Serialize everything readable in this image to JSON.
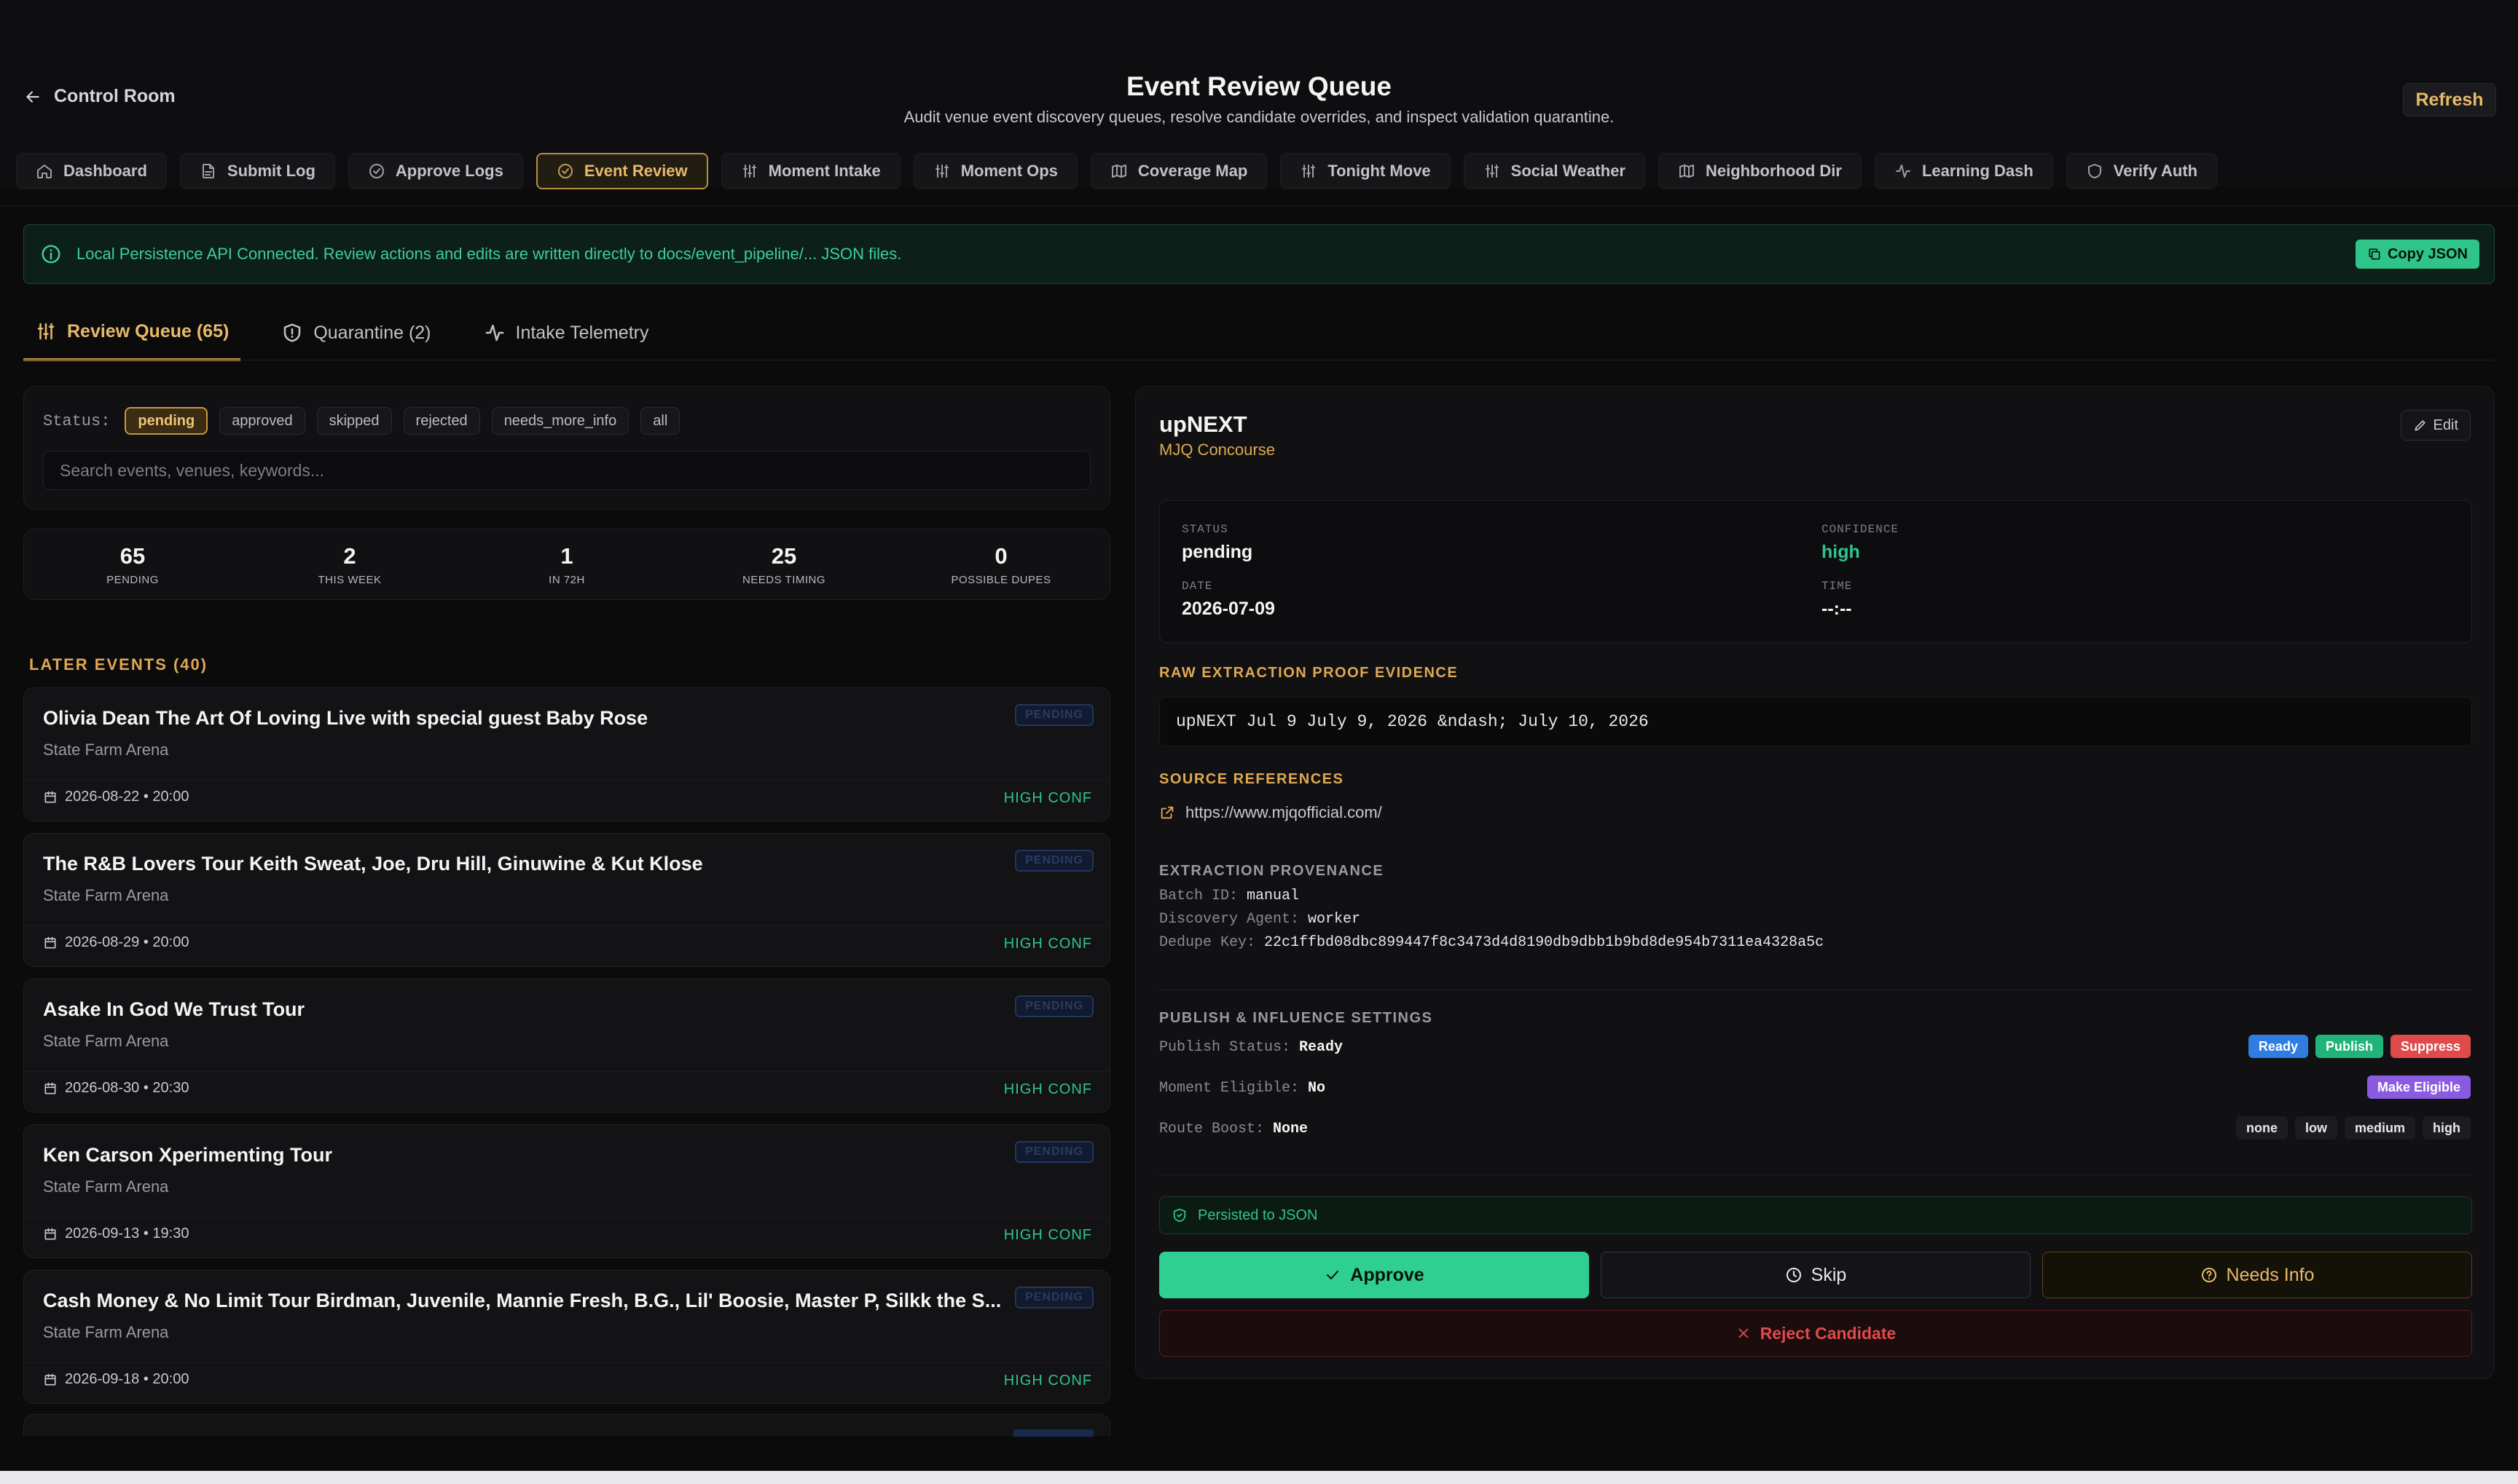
{
  "header": {
    "back_label": "Control Room",
    "title": "Event Review Queue",
    "subtitle": "Audit venue event discovery queues, resolve candidate overrides, and inspect validation quarantine.",
    "refresh_label": "Refresh"
  },
  "nav": [
    {
      "label": "Dashboard",
      "icon": "home-icon"
    },
    {
      "label": "Submit Log",
      "icon": "file-icon"
    },
    {
      "label": "Approve Logs",
      "icon": "check-circle-icon"
    },
    {
      "label": "Event Review",
      "icon": "check-circle-icon",
      "active": true
    },
    {
      "label": "Moment Intake",
      "icon": "sliders-icon"
    },
    {
      "label": "Moment Ops",
      "icon": "sliders-icon"
    },
    {
      "label": "Coverage Map",
      "icon": "map-icon"
    },
    {
      "label": "Tonight Move",
      "icon": "sliders-icon"
    },
    {
      "label": "Social Weather",
      "icon": "sliders-icon"
    },
    {
      "label": "Neighborhood Dir",
      "icon": "map-icon"
    },
    {
      "label": "Learning Dash",
      "icon": "activity-icon"
    },
    {
      "label": "Verify Auth",
      "icon": "shield-icon"
    }
  ],
  "banner": {
    "text": "Local Persistence API Connected. Review actions and edits are written directly to docs/event_pipeline/... JSON files.",
    "copy_label": "Copy JSON"
  },
  "subtabs": [
    {
      "label": "Review Queue (65)",
      "active": true
    },
    {
      "label": "Quarantine (2)"
    },
    {
      "label": "Intake Telemetry"
    }
  ],
  "filters": {
    "status_label": "Status:",
    "chips": [
      "pending",
      "approved",
      "skipped",
      "rejected",
      "needs_more_info",
      "all"
    ],
    "active_chip": "pending",
    "search_placeholder": "Search events, venues, keywords..."
  },
  "stats": [
    {
      "value": "65",
      "label": "PENDING"
    },
    {
      "value": "2",
      "label": "THIS WEEK"
    },
    {
      "value": "1",
      "label": "IN 72H"
    },
    {
      "value": "25",
      "label": "NEEDS TIMING"
    },
    {
      "value": "0",
      "label": "POSSIBLE DUPES"
    }
  ],
  "section_title": "LATER EVENTS (40)",
  "events": [
    {
      "title": "Olivia Dean The Art Of Loving Live with special guest Baby Rose",
      "venue": "State Farm Arena",
      "datetime": "2026-08-22 • 20:00",
      "badge": "PENDING",
      "conf": "HIGH CONF"
    },
    {
      "title": "The R&B Lovers Tour Keith Sweat, Joe, Dru Hill, Ginuwine & Kut Klose",
      "venue": "State Farm Arena",
      "datetime": "2026-08-29 • 20:00",
      "badge": "PENDING",
      "conf": "HIGH CONF"
    },
    {
      "title": "Asake In God We Trust Tour",
      "venue": "State Farm Arena",
      "datetime": "2026-08-30 • 20:30",
      "badge": "PENDING",
      "conf": "HIGH CONF"
    },
    {
      "title": "Ken Carson Xperimenting Tour",
      "venue": "State Farm Arena",
      "datetime": "2026-09-13 • 19:30",
      "badge": "PENDING",
      "conf": "HIGH CONF"
    },
    {
      "title": "Cash Money & No Limit Tour Birdman, Juvenile, Mannie Fresh, B.G., Lil' Boosie, Master P, Silkk the S...",
      "venue": "State Farm Arena",
      "datetime": "2026-09-18 • 20:00",
      "badge": "PENDING",
      "conf": "HIGH CONF"
    }
  ],
  "detail": {
    "name": "upNEXT",
    "venue": "MJQ Concourse",
    "edit_label": "Edit",
    "status_key": "STATUS",
    "status_value": "pending",
    "confidence_key": "CONFIDENCE",
    "confidence_value": "high",
    "date_key": "DATE",
    "date_value": "2026-07-09",
    "time_key": "TIME",
    "time_value": "--:--",
    "raw_heading": "RAW EXTRACTION PROOF EVIDENCE",
    "raw_text": "upNEXT Jul 9 July 9, 2026 &ndash; July 10, 2026",
    "sources_heading": "SOURCE REFERENCES",
    "source_url": "https://www.mjqofficial.com/",
    "prov_heading": "EXTRACTION PROVENANCE",
    "batch_key": "Batch ID:",
    "batch_value": "manual",
    "agent_key": "Discovery Agent:",
    "agent_value": "worker",
    "dedupe_key": "Dedupe Key:",
    "dedupe_value": "22c1ffbd08dbc899447f8c3473d4d8190db9dbb1b9bd8de954b7311ea4328a5c",
    "publish_heading": "PUBLISH & INFLUENCE SETTINGS",
    "publish_key": "Publish Status:",
    "publish_value": "Ready",
    "publish_pills": [
      "Ready",
      "Publish",
      "Suppress"
    ],
    "moment_key": "Moment Eligible:",
    "moment_value": "No",
    "moment_pill": "Make Eligible",
    "route_key": "Route Boost:",
    "route_value": "None",
    "route_pills": [
      "none",
      "low",
      "medium",
      "high"
    ],
    "persisted_label": "Persisted to JSON",
    "approve_label": "Approve",
    "skip_label": "Skip",
    "needs_info_label": "Needs Info",
    "reject_label": "Reject Candidate"
  },
  "colors": {
    "accent": "#e0a852",
    "success": "#2fc48a",
    "danger": "#e14a4a",
    "info": "#2f7de1",
    "purple": "#8a5be0"
  }
}
